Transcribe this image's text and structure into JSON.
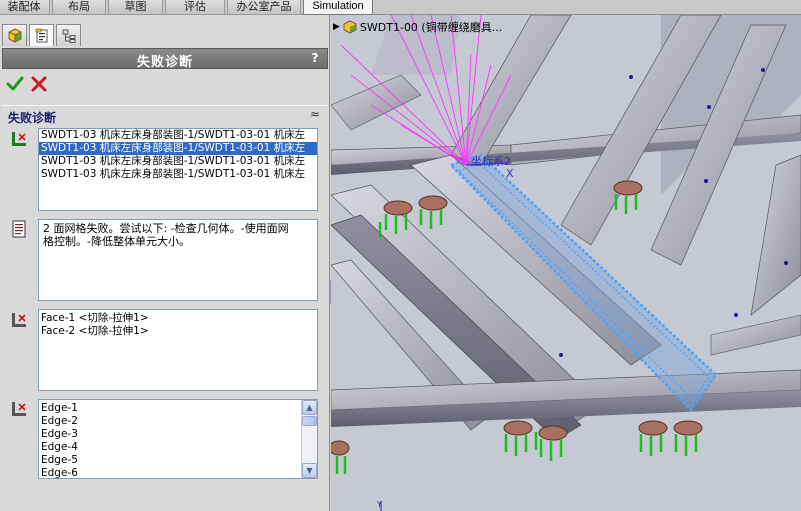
{
  "ribbon": {
    "tabs": [
      {
        "label": "装配体"
      },
      {
        "label": "布局"
      },
      {
        "label": "草图"
      },
      {
        "label": "评估"
      },
      {
        "label": "办公室产品"
      },
      {
        "label": "Simulation"
      }
    ],
    "active_tab": "Simulation"
  },
  "manager_tabs": [
    {
      "icon": "feature-manager-icon"
    },
    {
      "icon": "property-manager-icon"
    },
    {
      "icon": "configuration-manager-icon"
    }
  ],
  "property_manager": {
    "title": "失败诊断",
    "help": "?",
    "ok_icon": "check-icon",
    "cancel_icon": "cross-icon",
    "section": {
      "label": "失败诊断",
      "collapse_glyph": "≈"
    },
    "failed_parts": [
      "SWDT1-03  机床左床身部装图-1/SWDT1-03-01  机床左",
      "SWDT1-03  机床左床身部装图-1/SWDT1-03-01  机床左",
      "SWDT1-03  机床左床身部装图-1/SWDT1-03-01  机床左",
      "SWDT1-03  机床左床身部装图-1/SWDT1-03-01  机床左"
    ],
    "selected_part_index": 1,
    "message_line1": "2 面网格失败。尝试以下: -检查几何体。-使用面网",
    "message_line2": "格控制。-降低整体单元大小。",
    "faces": [
      "Face-1 <切除-拉伸1>",
      "Face-2 <切除-拉伸1>"
    ],
    "edges": [
      "Edge-1",
      "Edge-2",
      "Edge-3",
      "Edge-4",
      "Edge-5",
      "Edge-6"
    ]
  },
  "viewport": {
    "tree_label": "SWDT1-00  (铜带缠绕磨具...",
    "coord_label": "坐标系2",
    "axis_x": "X",
    "axis_y": "Y",
    "colors": {
      "background": "#c4c9d4",
      "frame": "#a9a9b6",
      "selection": "#4aa3ff",
      "force_arrows": "#22dd22",
      "connector": "#ff33ff"
    }
  }
}
